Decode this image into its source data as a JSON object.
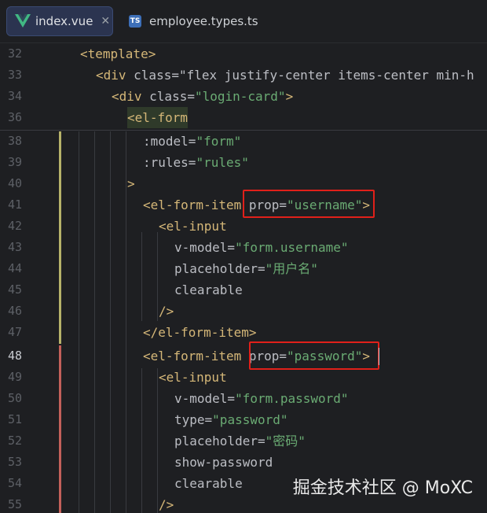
{
  "tabs": [
    {
      "label": "index.vue",
      "icon": "vue-logo-icon",
      "active": true
    },
    {
      "label": "employee.types.ts",
      "icon": "ts-file-icon",
      "active": false
    }
  ],
  "lines": [
    {
      "n": "32",
      "text": "<template>"
    },
    {
      "n": "33",
      "text": "<div class=\"flex justify-center items-center min-h"
    },
    {
      "n": "34",
      "text": "<div class=\"login-card\">"
    },
    {
      "n": "36",
      "text": "<el-form"
    },
    {
      "n": "38",
      "text": ":model=\"form\""
    },
    {
      "n": "39",
      "text": ":rules=\"rules\""
    },
    {
      "n": "40",
      "text": ">"
    },
    {
      "n": "41",
      "text": "<el-form-item prop=\"username\">"
    },
    {
      "n": "42",
      "text": "<el-input"
    },
    {
      "n": "43",
      "text": "v-model=\"form.username\""
    },
    {
      "n": "44",
      "text": "placeholder=\"用户名\""
    },
    {
      "n": "45",
      "text": "clearable"
    },
    {
      "n": "46",
      "text": "/>"
    },
    {
      "n": "47",
      "text": "</el-form-item>"
    },
    {
      "n": "48",
      "text": "<el-form-item prop=\"password\">"
    },
    {
      "n": "49",
      "text": "<el-input"
    },
    {
      "n": "50",
      "text": "v-model=\"form.password\""
    },
    {
      "n": "51",
      "text": "type=\"password\""
    },
    {
      "n": "52",
      "text": "placeholder=\"密码\""
    },
    {
      "n": "53",
      "text": "show-password"
    },
    {
      "n": "54",
      "text": "clearable"
    },
    {
      "n": "55",
      "text": "/>"
    }
  ],
  "watermark": "掘金技术社区 @ MoXC",
  "colors": {
    "tag": "#d5b778",
    "string": "#6aab73",
    "attr": "#bababa",
    "highlight_box": "#e0201a"
  }
}
